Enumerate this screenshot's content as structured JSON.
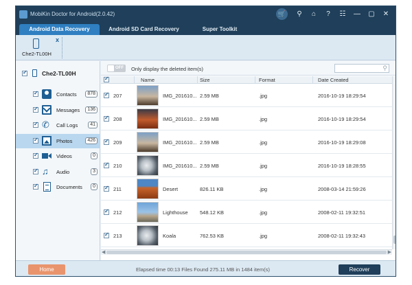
{
  "window": {
    "title": "MobiKin Doctor for Android(2.0.42)"
  },
  "titlebar_icons": [
    "cart-icon",
    "key-icon",
    "home-icon",
    "help-icon",
    "register-icon",
    "minimize-icon",
    "maximize-icon",
    "close-icon"
  ],
  "tabs": [
    {
      "label": "Android Data Recovery",
      "active": true
    },
    {
      "label": "Android SD Card Recovery",
      "active": false
    },
    {
      "label": "Super Toolkit",
      "active": false
    }
  ],
  "device": {
    "name": "Che2-TL00H",
    "close_glyph": "x"
  },
  "sidebar": {
    "root_label": "Che2-TL00H",
    "items": [
      {
        "label": "Contacts",
        "count": "878",
        "icon": "contacts-icon",
        "selected": false
      },
      {
        "label": "Messages",
        "count": "136",
        "icon": "messages-icon",
        "selected": false
      },
      {
        "label": "Call Logs",
        "count": "41",
        "icon": "call-logs-icon",
        "selected": false
      },
      {
        "label": "Photos",
        "count": "426",
        "icon": "photos-icon",
        "selected": true
      },
      {
        "label": "Videos",
        "count": "0",
        "icon": "videos-icon",
        "selected": false
      },
      {
        "label": "Audio",
        "count": "3",
        "icon": "audio-icon",
        "selected": false
      },
      {
        "label": "Documents",
        "count": "0",
        "icon": "documents-icon",
        "selected": false
      }
    ]
  },
  "filter": {
    "toggle_label": "OFF",
    "only_deleted_label": "Only display the deleted item(s)",
    "search_placeholder": ""
  },
  "table": {
    "columns": [
      "Name",
      "Size",
      "Format",
      "Date Created"
    ],
    "rows": [
      {
        "id": "207",
        "name": "IMG_201610...",
        "size": "2.59 MB",
        "format": ".jpg",
        "date": "2016-10-19 18:29:54",
        "thumb": "city"
      },
      {
        "id": "208",
        "name": "IMG_201610...",
        "size": "2.59 MB",
        "format": ".jpg",
        "date": "2016-10-19 18:29:54",
        "thumb": "sunset"
      },
      {
        "id": "209",
        "name": "IMG_201610...",
        "size": "2.59 MB",
        "format": ".jpg",
        "date": "2016-10-19 18:29:08",
        "thumb": "city"
      },
      {
        "id": "210",
        "name": "IMG_201610...",
        "size": "2.59 MB",
        "format": ".jpg",
        "date": "2016-10-19 18:28:55",
        "thumb": "koala"
      },
      {
        "id": "211",
        "name": "Desert",
        "size": "826.11 KB",
        "format": ".jpg",
        "date": "2008-03-14 21:59:26",
        "thumb": "desert"
      },
      {
        "id": "212",
        "name": "Lighthouse",
        "size": "548.12 KB",
        "format": ".jpg",
        "date": "2008-02-11 19:32:51",
        "thumb": "lighthouse"
      },
      {
        "id": "213",
        "name": "Koala",
        "size": "762.53 KB",
        "format": ".jpg",
        "date": "2008-02-11 19:32:43",
        "thumb": "koala"
      }
    ]
  },
  "footer": {
    "home_label": "Home",
    "status": "Elapsed time 00:13  Files Found 275.11 MB in 1484 item(s)",
    "recover_label": "Recover"
  },
  "colors": {
    "titlebar": "#1f3f5a",
    "active_tab": "#2f7fc1",
    "home_button": "#e9946c",
    "recover_button": "#1f3f5a",
    "selected_item": "#b9d7ef"
  }
}
